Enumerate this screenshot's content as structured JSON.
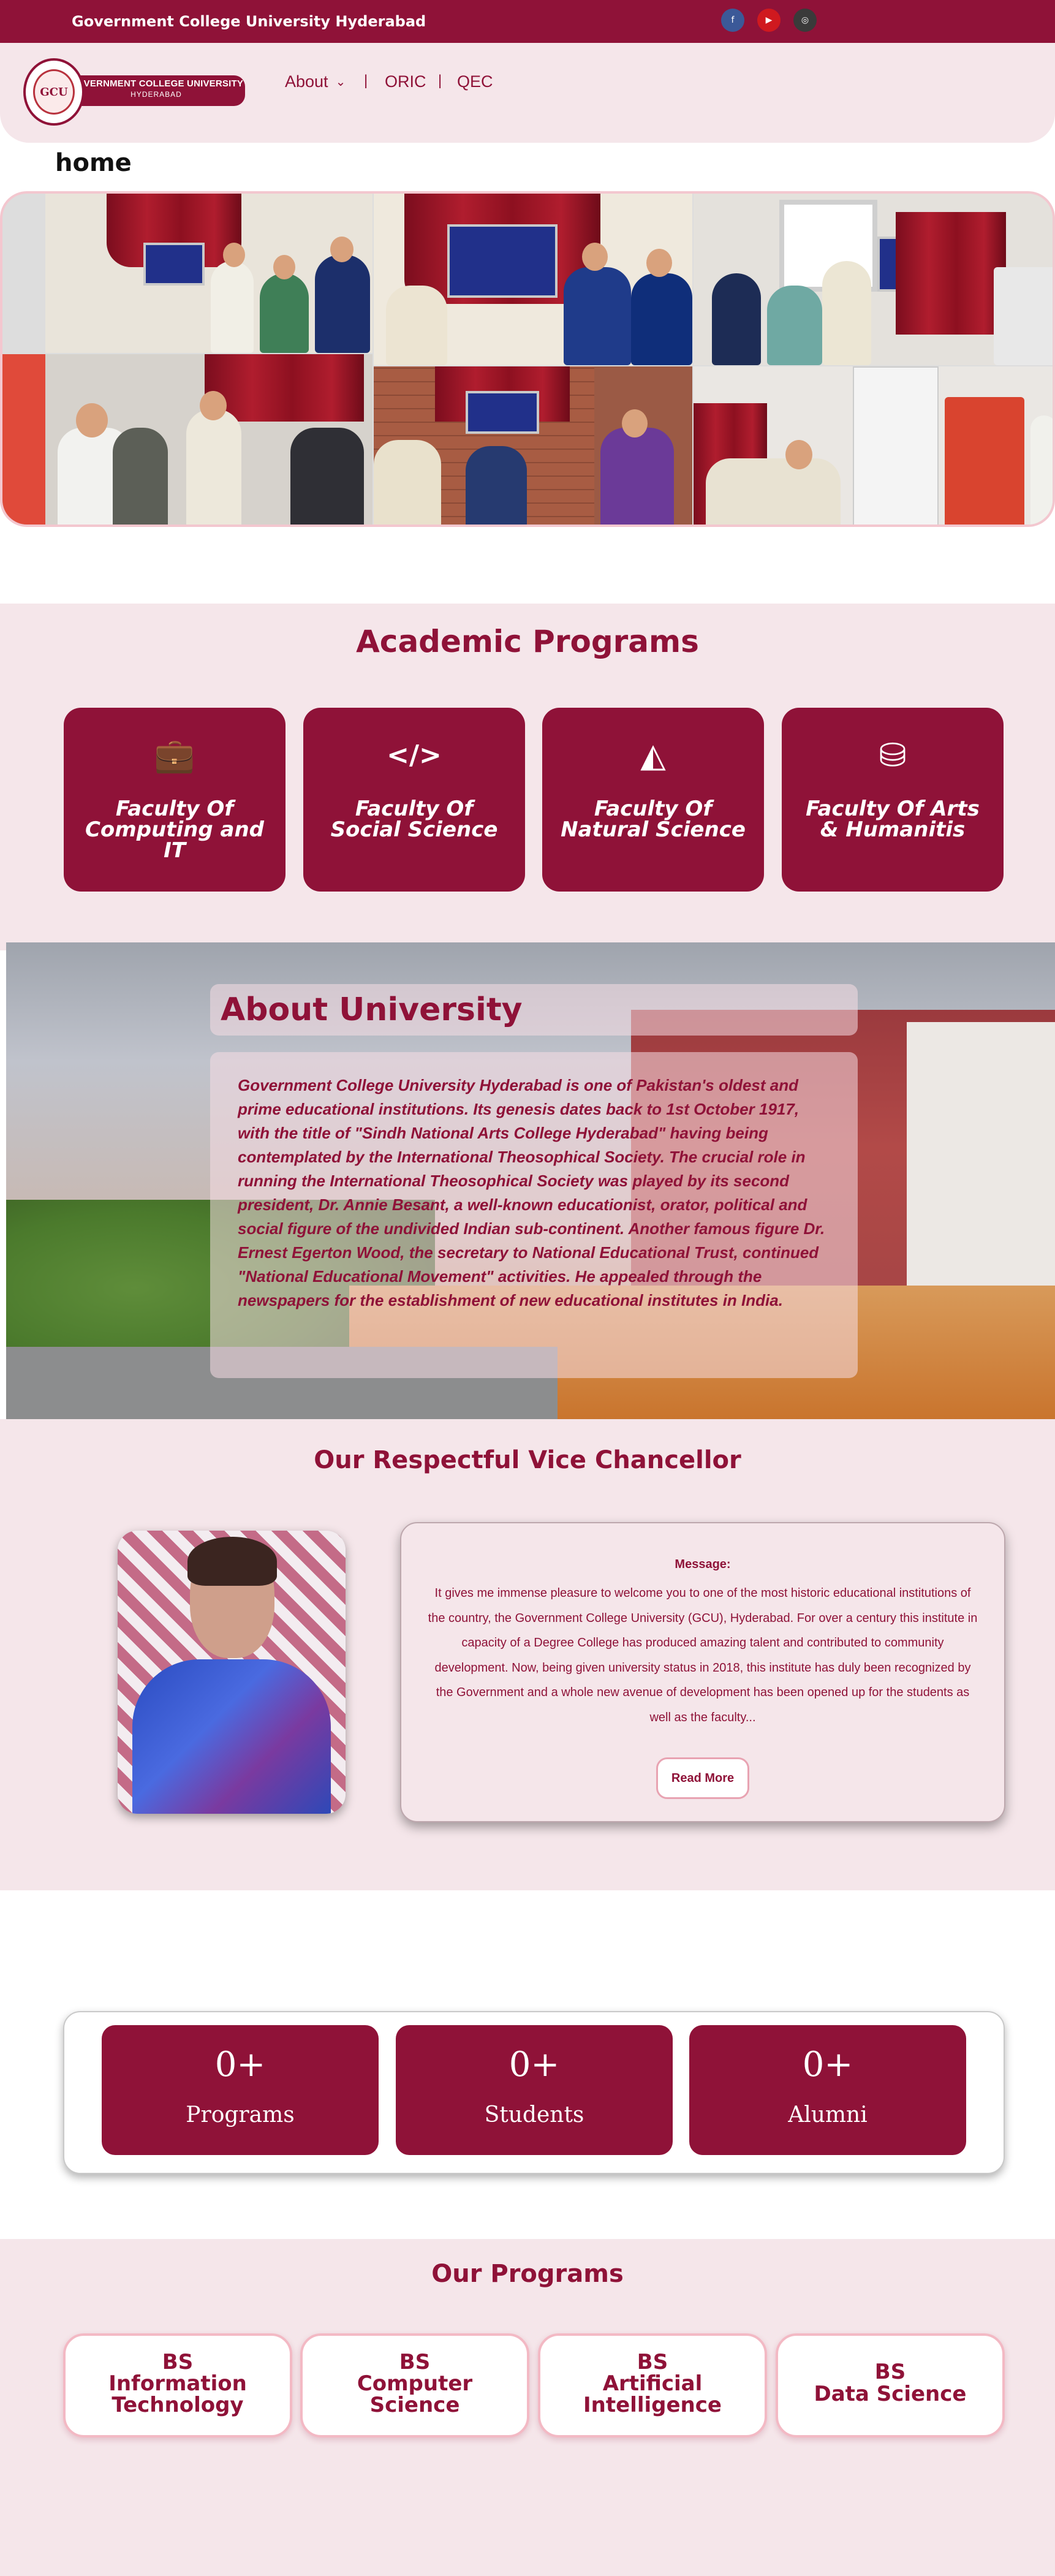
{
  "topbar": {
    "title": "Government College University Hyderabad",
    "social": {
      "facebook": "f",
      "youtube": "▶",
      "instagram": "◎"
    }
  },
  "logo": {
    "line1": "GOVERNMENT COLLEGE UNIVERSITY",
    "line2": "HYDERABAD",
    "seal": "GCU"
  },
  "nav": {
    "about": "About",
    "about_chevron": "⌄",
    "sep": "|",
    "oric": "ORIC",
    "qec": "QEC"
  },
  "page_title": "home",
  "academic": {
    "title": "Academic Programs",
    "faculties": [
      {
        "icon": "briefcase-clock-icon",
        "glyph": "💼",
        "name": "Faculty Of Computing and IT"
      },
      {
        "icon": "code-icon",
        "glyph": "</>",
        "name": "Faculty Of Social Science"
      },
      {
        "icon": "artstation-icon",
        "glyph": "◭",
        "name": "Faculty Of Natural Science"
      },
      {
        "icon": "database-icon",
        "glyph": "⛁",
        "name": "Faculty Of Arts & Humanitis"
      }
    ]
  },
  "about": {
    "title": "About University",
    "text": "Government College University Hyderabad is one of Pakistan's oldest and prime educational institutions. Its genesis dates back to 1st October 1917, with the title of \"Sindh National Arts College Hyderabad\" having being contemplated by the International Theosophical Society. The crucial role in running the International Theosophical Society was played by its second president, Dr. Annie Besant, a well-known educationist, orator, political and social figure of the undivided Indian sub-continent. Another famous figure Dr. Ernest Egerton Wood, the secretary to National Educational Trust, continued \"National Educational Movement\" activities. He appealed through the newspapers for the establishment of new educational institutes in India."
  },
  "vice_chancellor": {
    "title": "Our Respectful Vice Chancellor",
    "message_label": "Message:",
    "message": "It gives me immense pleasure to welcome you to one of the most historic educational institutions of the country, the Government College University (GCU), Hyderabad. For over a century this institute in capacity of a Degree College has produced amazing talent and contributed to community development. Now, being given university status in 2018, this institute has duly been recognized by the Government and a whole new avenue of development has been opened up for the students as well as the faculty...",
    "read_more": "Read More"
  },
  "stats": [
    {
      "value": "0+",
      "label": "Programs"
    },
    {
      "value": "0+",
      "label": "Students"
    },
    {
      "value": "0+",
      "label": "Alumni"
    }
  ],
  "programs": {
    "title": "Our Programs",
    "items": [
      {
        "line1": "BS",
        "line2": "Information",
        "line3": "Technology"
      },
      {
        "line1": "BS",
        "line2": "Computer",
        "line3": "Science"
      },
      {
        "line1": "BS",
        "line2": "Artificial",
        "line3": "Intelligence"
      },
      {
        "line1": "BS",
        "line2": "Data Science",
        "line3": ""
      }
    ]
  },
  "colors": {
    "brand": "#8f1238",
    "section_bg": "#f5e6ea",
    "card_border": "#f3b9c4"
  }
}
